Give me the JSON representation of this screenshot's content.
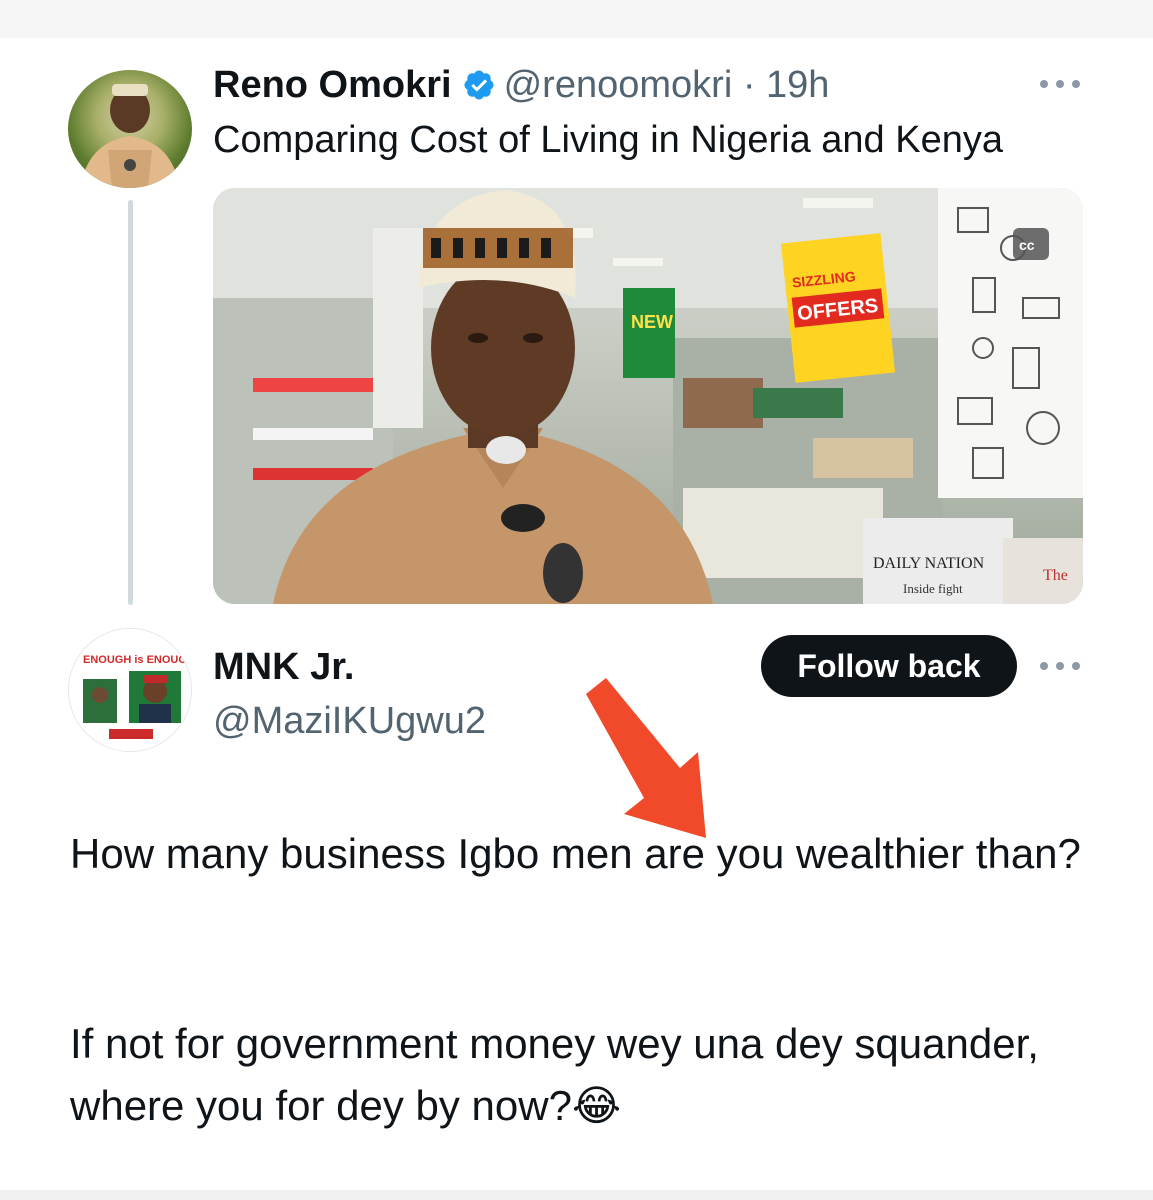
{
  "tweet": {
    "author_name": "Reno Omokri",
    "handle_time": "@renoomokri · 19h",
    "text": "Comparing Cost of Living in Nigeria and Kenya",
    "media_signs": {
      "sizzling": "SIZZLING",
      "offers": "OFFERS",
      "new": "NEW",
      "newspaper": "DAILY NATION",
      "newspaper_sub": "Inside fight",
      "newspaper2": "The"
    }
  },
  "reply": {
    "author_name": "MNK Jr.",
    "handle": "@MaziIKUgwu2",
    "follow_label": "Follow back",
    "avatar_banner": "ENOUGH is ENOUGH",
    "paragraph1": "How many business Igbo men are you wealthier than?",
    "paragraph2": "If not for government money wey una dey squander, where you for dey by now?😂"
  },
  "icons": {
    "verified": "verified-badge-icon",
    "more": "more-options-icon",
    "arrow": "red-arrow-annotation",
    "cc": "closed-captions-icon"
  },
  "colors": {
    "verified_blue": "#1d9bf0",
    "arrow_red": "#f04a2a",
    "follow_bg": "#0f1419"
  }
}
